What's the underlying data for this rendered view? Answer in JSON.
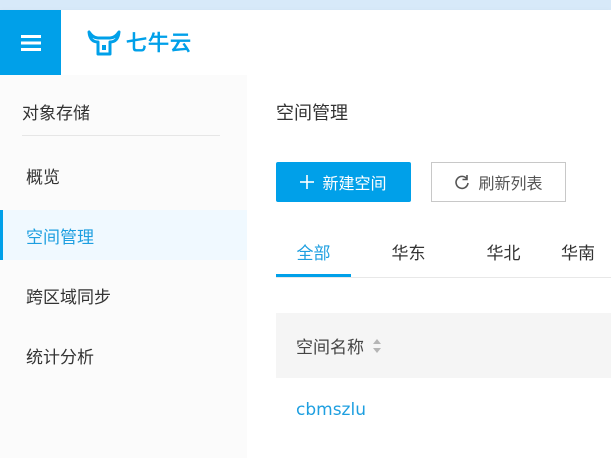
{
  "header": {
    "logo_text": "七牛云",
    "menu_icon": "hamburger-menu-icon"
  },
  "sidebar": {
    "title": "对象存储",
    "items": [
      {
        "label": "概览",
        "active": false
      },
      {
        "label": "空间管理",
        "active": true
      },
      {
        "label": "跨区域同步",
        "active": false
      },
      {
        "label": "统计分析",
        "active": false
      }
    ]
  },
  "main": {
    "title": "空间管理",
    "new_button": "新建空间",
    "refresh_button": "刷新列表",
    "tabs": [
      {
        "label": "全部",
        "active": true
      },
      {
        "label": "华东",
        "active": false
      },
      {
        "label": "华北",
        "active": false
      },
      {
        "label": "华南",
        "active": false
      }
    ],
    "table": {
      "columns": [
        "空间名称"
      ],
      "rows": [
        {
          "name": "cbmszlu"
        }
      ]
    }
  },
  "colors": {
    "brand": "#00a0e9",
    "link": "#1e9fe0"
  }
}
